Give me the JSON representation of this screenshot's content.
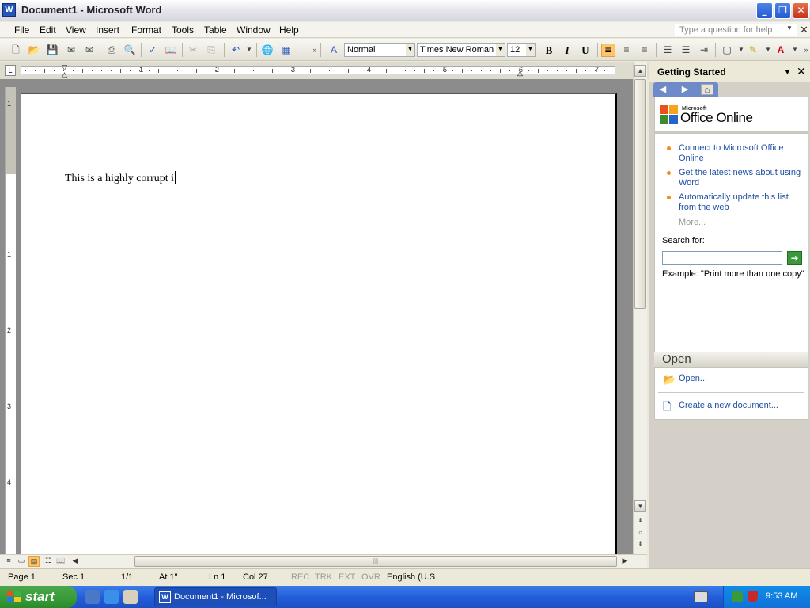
{
  "window": {
    "title": "Document1 - Microsoft Word",
    "app_icon": "W",
    "buttons": {
      "minimize": "_",
      "maximize": "❐",
      "close": "✕"
    }
  },
  "menu": {
    "items": [
      "File",
      "Edit",
      "View",
      "Insert",
      "Format",
      "Tools",
      "Table",
      "Window",
      "Help"
    ],
    "help_placeholder": "Type a question for help"
  },
  "toolbar": {
    "style": "Normal",
    "font": "Times New Roman",
    "size": "12",
    "bold": "B",
    "italic": "I",
    "underline": "U"
  },
  "ruler": {
    "numbers": [
      "1",
      "2",
      "3",
      "4",
      "5",
      "6",
      "7"
    ],
    "vertical_numbers": [
      "1",
      "1",
      "2",
      "3",
      "4"
    ]
  },
  "document": {
    "text": "This is a highly corrupt i"
  },
  "task_pane": {
    "title": "Getting Started",
    "logo_small": "Microsoft",
    "logo_text": "Office Online",
    "links": [
      "Connect to Microsoft Office Online",
      "Get the latest news about using Word",
      "Automatically update this list from the web"
    ],
    "more": "More...",
    "search_label": "Search for:",
    "search_value": "",
    "example": "Example:  \"Print more than one copy\"",
    "open_heading": "Open",
    "open_link": "Open...",
    "new_doc_link": "Create a new document..."
  },
  "status_bar": {
    "page": "Page  1",
    "sec": "Sec  1",
    "pages": "1/1",
    "at": "At  1\"",
    "ln": "Ln  1",
    "col": "Col  27",
    "rec": "REC",
    "trk": "TRK",
    "ext": "EXT",
    "ovr": "OVR",
    "language": "English (U.S"
  },
  "taskbar": {
    "start": "start",
    "task_item": "Document1 - Microsof...",
    "clock": "9:53 AM"
  },
  "colors": {
    "link": "#1f4ea3",
    "bullet": "#f28c1f",
    "active_button": "#ffc46a",
    "taskbar": "#245edb",
    "start": "#379b37"
  }
}
